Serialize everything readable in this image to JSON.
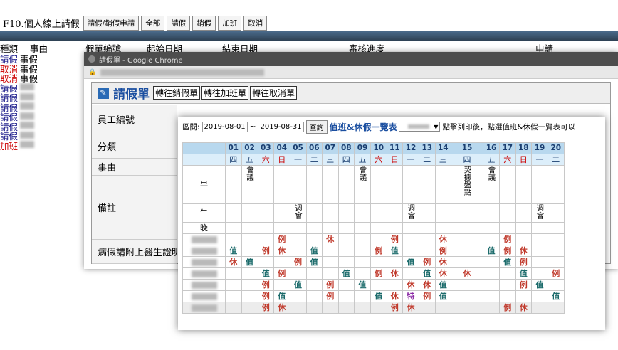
{
  "topbar": {
    "title": "F10.個人線上請假",
    "buttons": [
      "請假/銷假申請",
      "全部",
      "請假",
      "銷假",
      "加班",
      "取消"
    ]
  },
  "main_header": [
    "種類",
    "事由",
    "假單編號",
    "起始日期",
    "結束日期",
    "審核進度",
    "申請"
  ],
  "main_rows": [
    {
      "type": "請假",
      "reason": "事假",
      "type_red": false
    },
    {
      "type": "取消",
      "reason": "事假",
      "type_red": true
    },
    {
      "type": "取消",
      "reason": "事假",
      "type_red": true
    },
    {
      "type": "請假",
      "reason": "",
      "type_red": false
    },
    {
      "type": "請假",
      "reason": "",
      "type_red": false
    },
    {
      "type": "請假",
      "reason": "",
      "type_red": false
    },
    {
      "type": "請假",
      "reason": "",
      "type_red": false
    },
    {
      "type": "請假",
      "reason": "",
      "type_red": false
    },
    {
      "type": "請假",
      "reason": "",
      "type_red": false
    },
    {
      "type": "加班",
      "reason": "",
      "type_red": true
    }
  ],
  "chrome_window": {
    "title": "請假單 - Google Chrome"
  },
  "form": {
    "title": "請假單",
    "nav_buttons": [
      "轉往銷假單",
      "轉往加班單",
      "轉往取消單"
    ],
    "fields": [
      "員工編號",
      "分類",
      "事由",
      "備註",
      "病假請附上醫生證明"
    ]
  },
  "calendar": {
    "range_label": "區間:",
    "start_date": "2019-08-01",
    "tilde": "~",
    "end_date": "2019-08-31",
    "query_button": "查詢",
    "list_title": "值班&休假一覽表",
    "instruction": "點擊列印後，點選值班&休假一覽表可以",
    "days": [
      "01",
      "02",
      "03",
      "04",
      "05",
      "06",
      "07",
      "08",
      "09",
      "10",
      "11",
      "12",
      "13",
      "14",
      "15",
      "16",
      "17",
      "18",
      "19",
      "20"
    ],
    "weekdays": [
      "四",
      "五",
      "六",
      "日",
      "一",
      "二",
      "三",
      "四",
      "五",
      "六",
      "日",
      "一",
      "二",
      "三",
      "四",
      "五",
      "六",
      "日",
      "一",
      "二"
    ],
    "weekend_cols": [
      2,
      3,
      9,
      10,
      16,
      17
    ],
    "slot_rows": [
      {
        "label": "早",
        "cells": [
          "",
          "會議",
          "",
          "",
          "",
          "",
          "",
          "",
          "會議",
          "",
          "",
          "",
          "",
          "",
          "契據盤點",
          "會議",
          "",
          "",
          "",
          ""
        ]
      },
      {
        "label": "午",
        "cells": [
          "",
          "",
          "",
          "",
          "週會",
          "",
          "",
          "",
          "",
          "",
          "",
          "週會",
          "",
          "",
          "",
          "",
          "",
          "",
          "週會",
          ""
        ]
      },
      {
        "label": "晚",
        "cells": [
          "",
          "",
          "",
          "",
          "",
          "",
          "",
          "",
          "",
          "",
          "",
          "",
          "",
          "",
          "",
          "",
          "",
          "",
          "",
          ""
        ]
      }
    ],
    "staff_rows": [
      [
        "",
        "",
        "",
        "例",
        "",
        "",
        "休",
        "",
        "",
        "",
        "例",
        "",
        "",
        "休",
        "",
        "",
        "例",
        "",
        "",
        ""
      ],
      [
        "值",
        "",
        "例",
        "休",
        "",
        "值",
        "",
        "",
        "",
        "例",
        "值",
        "",
        "",
        "例",
        "",
        "值",
        "例",
        "休",
        "",
        ""
      ],
      [
        "休",
        "值",
        "",
        "",
        "例",
        "值",
        "",
        "",
        "",
        "",
        "",
        "值",
        "例",
        "休",
        "",
        "",
        "值",
        "例",
        "",
        ""
      ],
      [
        "",
        "",
        "值",
        "例",
        "",
        "",
        "",
        "值",
        "",
        "例",
        "休",
        "",
        "值",
        "休",
        "休",
        "",
        "",
        "值",
        "",
        "例"
      ],
      [
        "",
        "",
        "例",
        "",
        "值",
        "",
        "例",
        "",
        "值",
        "",
        "",
        "休",
        "休",
        "值",
        "",
        "",
        "",
        "例",
        "值",
        ""
      ],
      [
        "",
        "",
        "例",
        "值",
        "",
        "",
        "例",
        "",
        "",
        "值",
        "休",
        "特",
        "例",
        "值",
        "",
        "",
        "",
        "",
        "",
        "值"
      ],
      [
        "",
        "",
        "例",
        "休",
        "",
        "",
        "",
        "",
        "",
        "",
        "例",
        "休",
        "",
        "",
        "",
        "",
        "例",
        "休",
        "",
        ""
      ]
    ],
    "colors": {
      "rest": "#c0392b",
      "duty": "#1a6a6a",
      "special": "#8a2aa5"
    }
  }
}
